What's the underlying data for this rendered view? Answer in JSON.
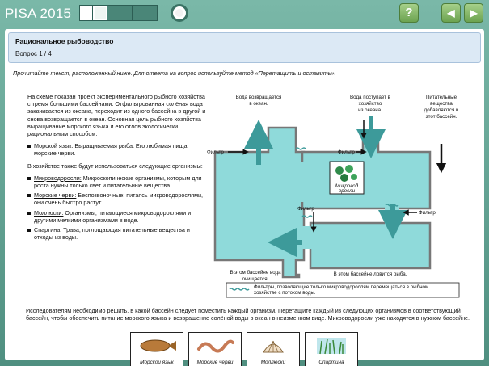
{
  "header": {
    "brand": "PISA 2015",
    "help_symbol": "?",
    "back_symbol": "◀",
    "next_symbol": "▶"
  },
  "question": {
    "title": "Рациональное рыбоводство",
    "number": "Вопрос 1 / 4",
    "instruction": "Прочитайте текст, расположенный ниже. Для ответа на вопрос используйте метод «Перетащить и оставить»."
  },
  "passage": {
    "intro": "На схеме показан проект экспериментального рыбного хозяйства с тремя большими бассейнами. Отфильтрованная солёная вода закачивается из океана, переходит из одного бассейна в другой и снова возвращается в океан. Основная цель рыбного хозяйства – выращивание морского языка и его отлов экологически рациональным способом.",
    "fish_term": "Морской язык:",
    "fish_desc": " Выращиваемая рыба. Его любимая пища: морские черви.",
    "also_used": "В хозяйстве также будут использоваться следующие организмы:",
    "organisms": [
      {
        "term": "Микроводоросли:",
        "desc": " Микроскопические организмы, которым для роста нужны только свет и питательные вещества."
      },
      {
        "term": "Морские черви:",
        "desc": " Беспозвоночные: питаясь микроводорослями, они очень быстро растут."
      },
      {
        "term": "Моллюски:",
        "desc": " Организмы, питающиеся микроводорослями и другими мелкими организмами в воде."
      },
      {
        "term": "Спартина:",
        "desc": " Трава, поглощающая питательные вещества и отходы из воды."
      }
    ],
    "task": "Исследователям необходимо решить, в какой бассейн следует поместить каждый организм. Перетащите каждый из следующих организмов в соответствующий бассейн, чтобы обеспечить питание морского языка и возвращение солёной воды в океан в неизменном виде. Микроводоросли уже находятся в нужном бассейне."
  },
  "diagram": {
    "water_returns": [
      "Вода возвращается",
      "в океан."
    ],
    "water_enters": [
      "Вода поступает в",
      "хозяйство",
      "из океана."
    ],
    "nutrients": [
      "Питательные",
      "вещества",
      "добавляются в",
      "этот бассейн."
    ],
    "filter": "Фильтр",
    "microalgae_card": [
      "Микровод",
      "оросли"
    ],
    "pool_clean": [
      "В этом бассейне вода",
      "очищается."
    ],
    "pool_catch": "В этом бассейне ловится рыба.",
    "legend": [
      "Фильтры, позволяющие только микроводорослям перемещаться в рыбном",
      "хозяйстве с потоком воды."
    ]
  },
  "cards": [
    {
      "id": "sole",
      "label": "Морской язык"
    },
    {
      "id": "worms",
      "label": "Морские черви"
    },
    {
      "id": "mollusks",
      "label": "Моллюски"
    },
    {
      "id": "spartina",
      "label": "Спартина"
    }
  ],
  "colors": {
    "water": "#8fdada",
    "arrow": "#3d9a9a",
    "tank_border": "#777777",
    "header_bg": "#dce9f5"
  }
}
